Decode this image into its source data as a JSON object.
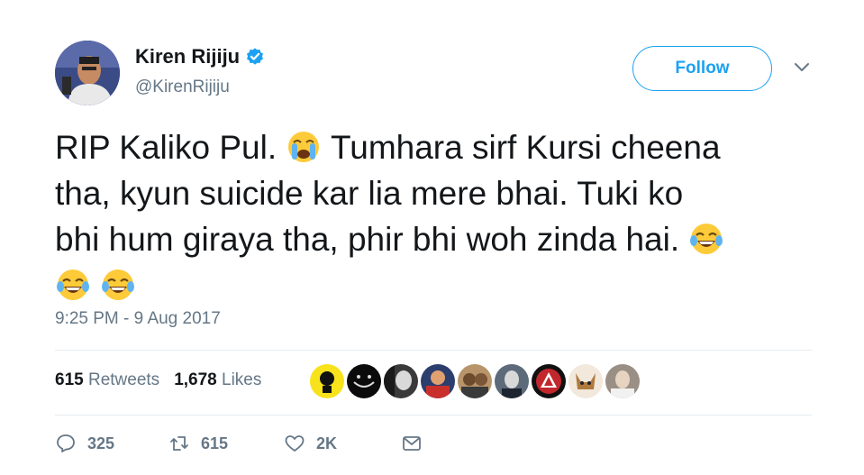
{
  "author": {
    "name": "Kiren Rijiju",
    "handle": "@KirenRijiju",
    "verified_icon": "verified-badge-icon",
    "avatar_icon": "profile-photo-avatar"
  },
  "follow_label": "Follow",
  "tweet": {
    "line1": "RIP Kaliko Pul.",
    "line1b": "Tumhara sirf Kursi cheena",
    "line2": "tha, kyun suicide kar lia mere bhai. Tuki ko",
    "line3": "bhi hum giraya tha, phir bhi woh zinda hai.",
    "emojis": [
      "loudly-crying-face-icon",
      "face-with-tears-of-joy-icon",
      "face-with-tears-of-joy-icon",
      "face-with-tears-of-joy-icon"
    ]
  },
  "timestamp": "9:25 PM - 9 Aug 2017",
  "stats": {
    "retweets_count": "615",
    "retweets_label": "Retweets",
    "likes_count": "1,678",
    "likes_label": "Likes"
  },
  "likers_count_shown": 9,
  "actions": {
    "replies": "325",
    "retweets": "615",
    "likes": "2K"
  },
  "colors": {
    "accent": "#1da1f2",
    "text": "#14171a",
    "secondary": "#657786",
    "divider": "#e6ecf0"
  }
}
